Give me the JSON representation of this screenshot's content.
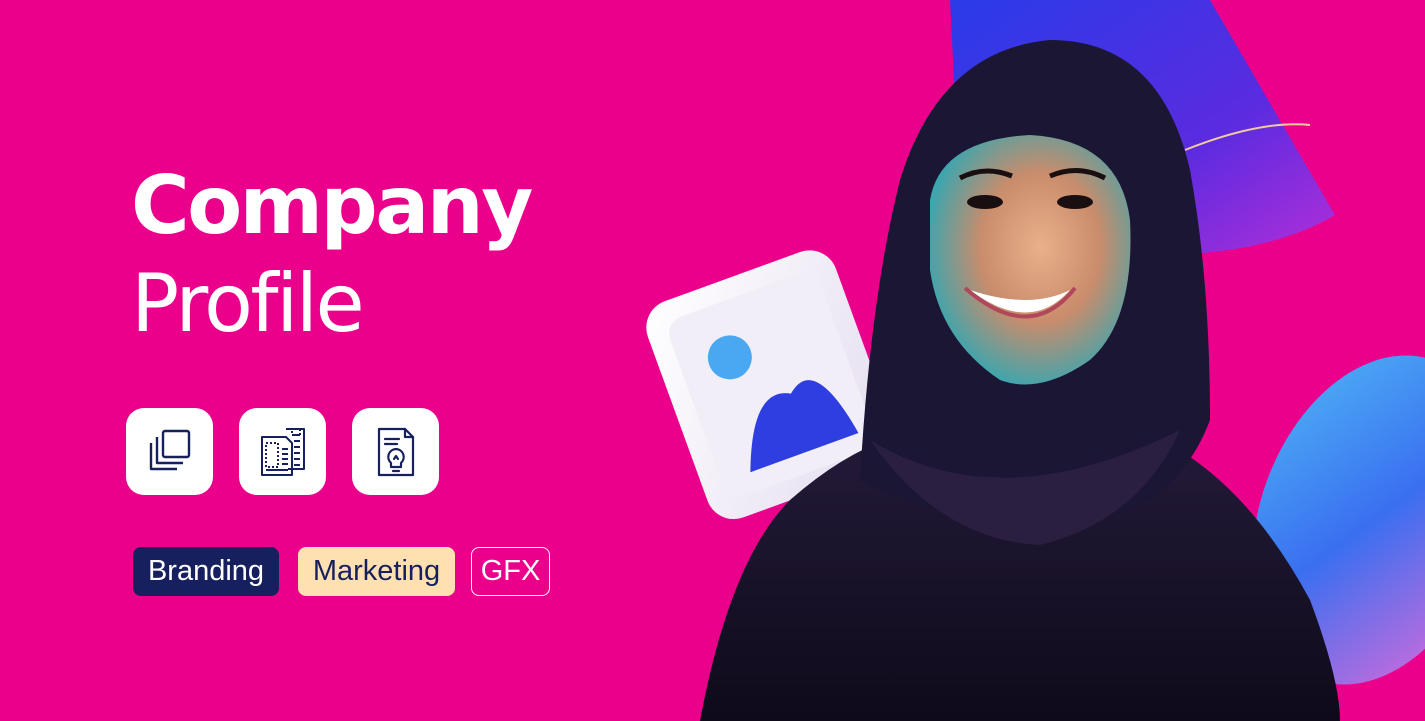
{
  "hero": {
    "title_line1": "Company",
    "title_line2": "Profile"
  },
  "icon_tiles": [
    {
      "icon": "copy-stack-icon"
    },
    {
      "icon": "document-pages-icon"
    },
    {
      "icon": "lightbulb-document-icon"
    }
  ],
  "tags": [
    {
      "label": "Branding",
      "background": "#16205E",
      "text_color": "#FFFFFF"
    },
    {
      "label": "Marketing",
      "background": "#FFE0B0",
      "text_color": "#16205E"
    },
    {
      "label": "GFX",
      "background": "transparent",
      "text_color": "#FFFFFF"
    }
  ],
  "colors": {
    "background": "#EB008C",
    "navy": "#16205E",
    "cream": "#FFE0B0",
    "white": "#FFFFFF"
  }
}
